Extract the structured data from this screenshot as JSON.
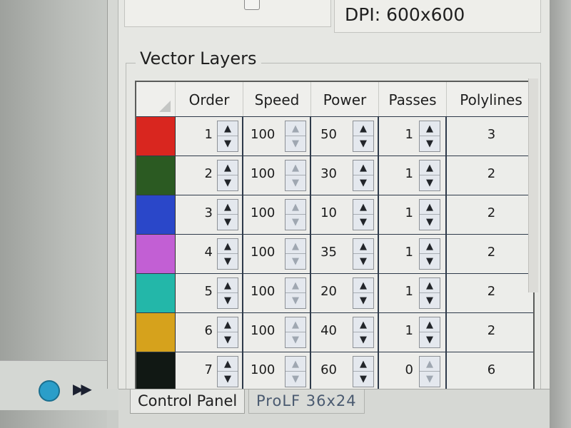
{
  "settings": {
    "dpi_text": "DPI: 600x600"
  },
  "vector_layers": {
    "title": "Vector Layers",
    "columns": [
      "Order",
      "Speed",
      "Power",
      "Passes",
      "Polylines"
    ],
    "rows": [
      {
        "color": "#d9261f",
        "order": "1",
        "speed": "100",
        "power": "50",
        "passes": "1",
        "polylines": "3"
      },
      {
        "color": "#2b5a22",
        "order": "2",
        "speed": "100",
        "power": "30",
        "passes": "1",
        "polylines": "2"
      },
      {
        "color": "#2a47c9",
        "order": "3",
        "speed": "100",
        "power": "10",
        "passes": "1",
        "polylines": "2"
      },
      {
        "color": "#c25fd4",
        "order": "4",
        "speed": "100",
        "power": "35",
        "passes": "1",
        "polylines": "2"
      },
      {
        "color": "#23b7a9",
        "order": "5",
        "speed": "100",
        "power": "20",
        "passes": "1",
        "polylines": "2"
      },
      {
        "color": "#d6a21c",
        "order": "6",
        "speed": "100",
        "power": "40",
        "passes": "1",
        "polylines": "2"
      },
      {
        "color": "#111814",
        "order": "7",
        "speed": "100",
        "power": "60",
        "passes": "0",
        "polylines": "6"
      }
    ]
  },
  "tabs": [
    "Control Panel",
    "ProLF 36x24"
  ],
  "icons": {
    "play": "play-circle-icon",
    "fast_forward": "fast-forward-icon"
  }
}
